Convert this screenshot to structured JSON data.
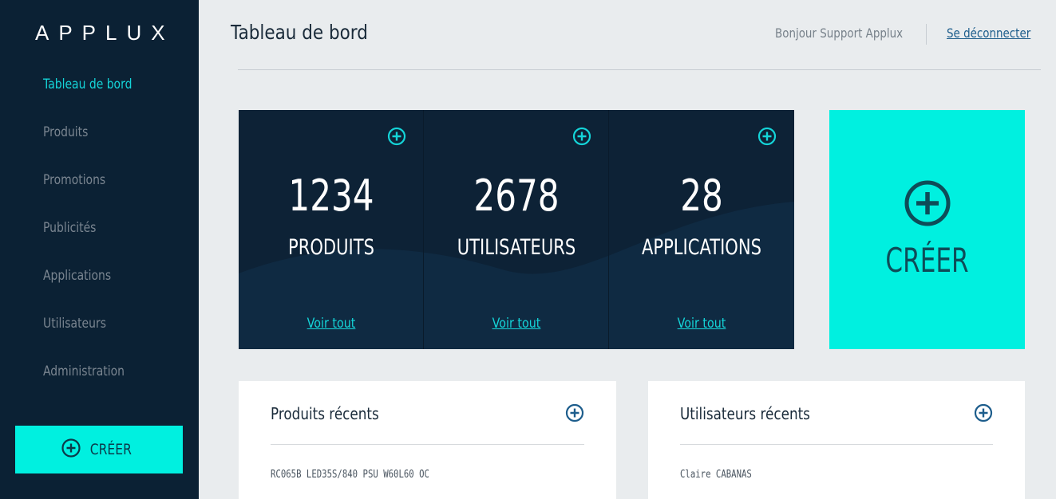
{
  "app": {
    "logo": "APPLUX"
  },
  "sidebar": {
    "items": [
      {
        "label": "Tableau de bord",
        "active": true
      },
      {
        "label": "Produits"
      },
      {
        "label": "Promotions"
      },
      {
        "label": "Publicités"
      },
      {
        "label": "Applications"
      },
      {
        "label": "Utilisateurs"
      },
      {
        "label": "Administration"
      }
    ],
    "create_label": "CRÉER"
  },
  "header": {
    "title": "Tableau de bord",
    "greeting": "Bonjour Support Applux",
    "logout": "Se déconnecter"
  },
  "stats": [
    {
      "value": "1234",
      "label": "PRODUITS",
      "link": "Voir tout"
    },
    {
      "value": "2678",
      "label": "UTILISATEURS",
      "link": "Voir tout"
    },
    {
      "value": "28",
      "label": "APPLICATIONS",
      "link": "Voir tout"
    }
  ],
  "create_card": {
    "label": "CRÉER"
  },
  "recent_products": {
    "title": "Produits récents",
    "items": [
      "RC065B LED35S/840 PSU W60L60 OC"
    ]
  },
  "recent_users": {
    "title": "Utilisateurs récents",
    "items": [
      "Claire CABANAS"
    ]
  },
  "colors": {
    "sidebar_bg": "#0b2134",
    "accent": "#00f0e0",
    "accent_text": "#14d4d8",
    "stats_bg": "#0d2236",
    "link_blue": "#1d5d8c"
  },
  "icons": [
    "plus-circle-icon"
  ]
}
